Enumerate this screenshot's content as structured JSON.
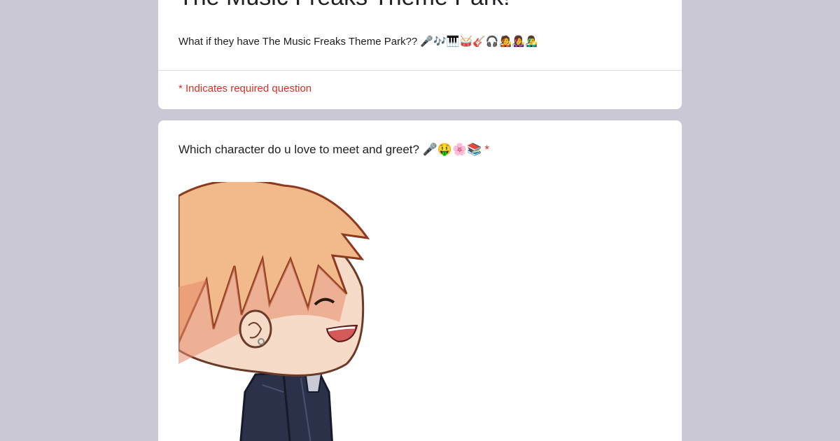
{
  "form": {
    "title": "The Music Freaks Theme Park!",
    "description": "What if they have The Music Freaks Theme Park?? 🎤🎶🎹🥁🎸🎧🧑‍🎤👩‍🎤👨‍🎤",
    "required_note": "* Indicates required question"
  },
  "question": {
    "title": "Which character do u love to meet and greet? 🎤🤑🌸📚",
    "required_marker": "*"
  },
  "colors": {
    "background": "#cbc8d6",
    "card": "#ffffff",
    "required": "#d93025",
    "text": "#202124",
    "divider": "#dadce0"
  }
}
